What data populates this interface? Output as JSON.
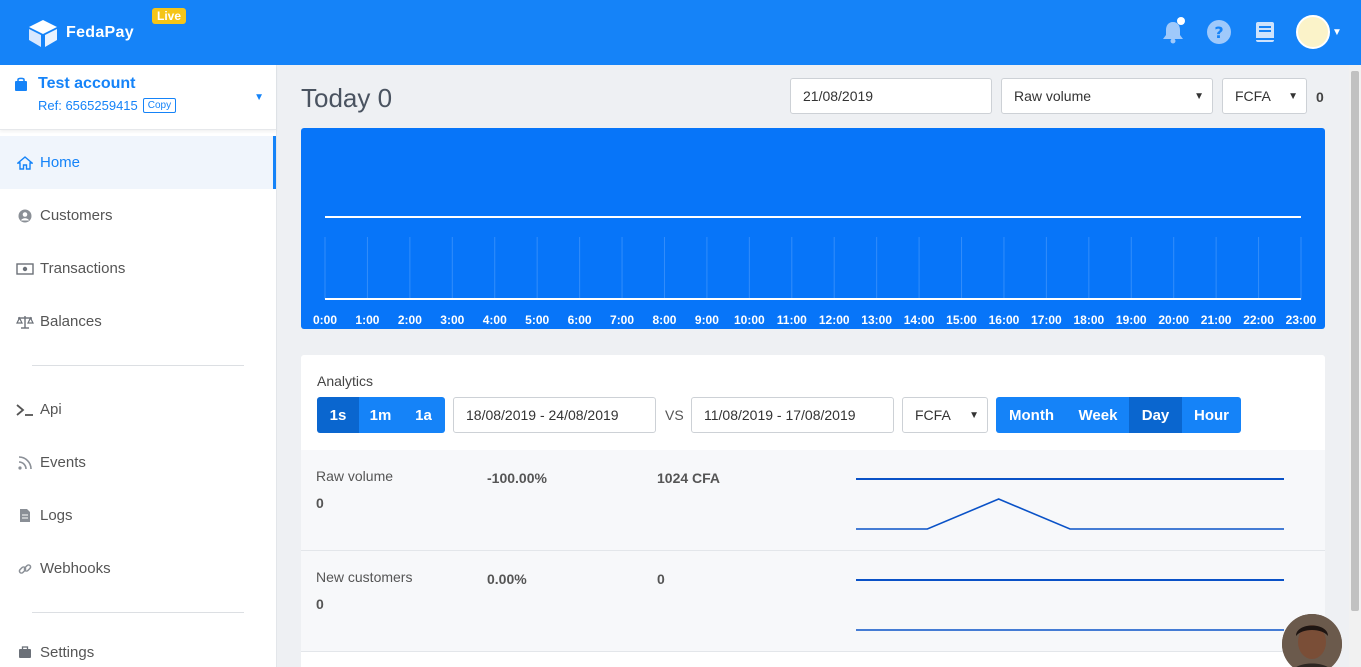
{
  "topbar": {
    "brand": "FedaPay",
    "live_badge": "Live",
    "icons": [
      "cube-logo-icon",
      "bell-icon",
      "help-icon",
      "book-icon",
      "user-avatar"
    ]
  },
  "account": {
    "name": "Test account",
    "ref_label": "Ref: 6565259415",
    "copy_label": "Copy"
  },
  "sidebar": {
    "items": [
      {
        "label": "Home",
        "icon": "home-icon"
      },
      {
        "label": "Customers",
        "icon": "user-circle-icon"
      },
      {
        "label": "Transactions",
        "icon": "money-icon"
      },
      {
        "label": "Balances",
        "icon": "scale-icon"
      },
      {
        "label": "Api",
        "icon": "terminal-icon"
      },
      {
        "label": "Events",
        "icon": "rss-icon"
      },
      {
        "label": "Logs",
        "icon": "file-icon"
      },
      {
        "label": "Webhooks",
        "icon": "link-icon"
      },
      {
        "label": "Settings",
        "icon": "briefcase-icon"
      }
    ]
  },
  "header": {
    "title": "Today 0",
    "date_value": "21/08/2019",
    "metric_select": "Raw volume",
    "currency_select": "FCFA",
    "total": "0"
  },
  "chart_data": {
    "type": "line",
    "x": [
      "0:00",
      "1:00",
      "2:00",
      "3:00",
      "4:00",
      "5:00",
      "6:00",
      "7:00",
      "8:00",
      "9:00",
      "10:00",
      "11:00",
      "12:00",
      "13:00",
      "14:00",
      "15:00",
      "16:00",
      "17:00",
      "18:00",
      "19:00",
      "20:00",
      "21:00",
      "22:00",
      "23:00"
    ],
    "series": [
      {
        "values": [
          0,
          0,
          0,
          0,
          0,
          0,
          0,
          0,
          0,
          0,
          0,
          0,
          0,
          0,
          0,
          0,
          0,
          0,
          0,
          0,
          0,
          0,
          0,
          0
        ]
      }
    ],
    "colors": {
      "background": "#0775f9",
      "line": "#ffffff"
    }
  },
  "analytics": {
    "title": "Analytics",
    "range_buttons": [
      "1s",
      "1m",
      "1a"
    ],
    "range_selected": "1s",
    "period_current": "18/08/2019 - 24/08/2019",
    "vs_label": "VS",
    "period_compare": "11/08/2019 - 17/08/2019",
    "currency": "FCFA",
    "granularity_buttons": [
      "Month",
      "Week",
      "Day",
      "Hour"
    ],
    "granularity_selected": "Day",
    "rows": [
      {
        "label": "Raw volume",
        "value": "0",
        "change": "-100.00%",
        "amount": "1024 CFA",
        "spark": [
          0,
          0,
          1024,
          0,
          0,
          0,
          0
        ]
      },
      {
        "label": "New customers",
        "value": "0",
        "change": "0.00%",
        "amount": "0",
        "spark": [
          0,
          0,
          0,
          0,
          0,
          0,
          0
        ]
      }
    ]
  },
  "colors": {
    "accent": "#1583f8",
    "live": "#f5c518"
  }
}
